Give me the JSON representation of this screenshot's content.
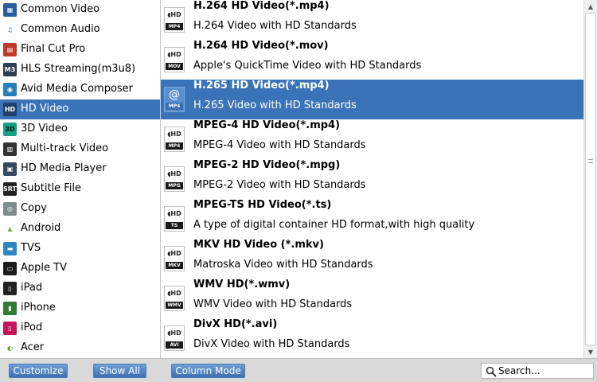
{
  "sidebar": {
    "items": [
      {
        "label": "Common Video",
        "icon": "film-icon",
        "glyph": "▦",
        "color": "#2b5d9c",
        "fg": "#fff"
      },
      {
        "label": "Common Audio",
        "icon": "music-note-icon",
        "glyph": "♫",
        "color": "transparent",
        "fg": "#2f6fbf"
      },
      {
        "label": "Final Cut Pro",
        "icon": "clapperboard-icon",
        "glyph": "▤",
        "color": "#c0392b",
        "fg": "#fff"
      },
      {
        "label": "HLS Streaming(m3u8)",
        "icon": "m3u8-icon",
        "glyph": "M3",
        "color": "#2c3e50",
        "fg": "#fff"
      },
      {
        "label": "Avid Media Composer",
        "icon": "avid-icon",
        "glyph": "◉",
        "color": "#2980b9",
        "fg": "#fff"
      },
      {
        "label": "HD Video",
        "icon": "hd-icon",
        "glyph": "HD",
        "color": "#1f3f66",
        "fg": "#fff"
      },
      {
        "label": "3D Video",
        "icon": "3d-icon",
        "glyph": "3D",
        "color": "#16a085",
        "fg": "#111"
      },
      {
        "label": "Multi-track Video",
        "icon": "filmstrip-icon",
        "glyph": "▥",
        "color": "#333333",
        "fg": "#fff"
      },
      {
        "label": "HD Media Player",
        "icon": "media-player-icon",
        "glyph": "▣",
        "color": "#34495e",
        "fg": "#fff"
      },
      {
        "label": "Subtitle File",
        "icon": "subtitle-icon",
        "glyph": "SRT",
        "color": "#222222",
        "fg": "#fff"
      },
      {
        "label": "Copy",
        "icon": "disc-copy-icon",
        "glyph": "◎",
        "color": "#7f8c8d",
        "fg": "#fff"
      },
      {
        "label": "Android",
        "icon": "android-icon",
        "glyph": "▲",
        "color": "transparent",
        "fg": "#7cb342"
      },
      {
        "label": "TVS",
        "icon": "tv-icon",
        "glyph": "▬",
        "color": "#2e86c1",
        "fg": "#fff"
      },
      {
        "label": "Apple TV",
        "icon": "apple-tv-icon",
        "glyph": "▭",
        "color": "#1c1c1c",
        "fg": "#fff"
      },
      {
        "label": "iPad",
        "icon": "ipad-icon",
        "glyph": "▯",
        "color": "#222222",
        "fg": "#fff"
      },
      {
        "label": "iPhone",
        "icon": "iphone-icon",
        "glyph": "▮",
        "color": "#2e7d32",
        "fg": "#fff"
      },
      {
        "label": "iPod",
        "icon": "ipod-icon",
        "glyph": "▯",
        "color": "#c2185b",
        "fg": "#fff"
      },
      {
        "label": "Acer",
        "icon": "acer-icon",
        "glyph": "◐",
        "color": "transparent",
        "fg": "#5a9e2f"
      }
    ],
    "selected_index": 5
  },
  "formats": {
    "items": [
      {
        "name": "H.264 HD Video(*.mp4)",
        "desc": "H.264 Video with HD Standards",
        "hd": "◖HD",
        "ext": "MP4"
      },
      {
        "name": "H.264 HD Video(*.mov)",
        "desc": "Apple's QuickTime Video with HD Standards",
        "hd": "◖HD",
        "ext": "MOV"
      },
      {
        "name": "H.265 HD Video(*.mp4)",
        "desc": "H.265 Video with HD Standards",
        "hd": "@",
        "ext": "MP4"
      },
      {
        "name": "MPEG-4 HD Video(*.mp4)",
        "desc": "MPEG-4 Video with HD Standards",
        "hd": "◖HD",
        "ext": "MP4"
      },
      {
        "name": "MPEG-2 HD Video(*.mpg)",
        "desc": "MPEG-2 Video with HD Standards",
        "hd": "◖HD",
        "ext": "MPG"
      },
      {
        "name": "MPEG-TS HD Video(*.ts)",
        "desc": "A type of digital container HD format,with high quality",
        "hd": "◖HD",
        "ext": "TS"
      },
      {
        "name": "MKV HD Video (*.mkv)",
        "desc": "Matroska Video with HD Standards",
        "hd": "◖HD",
        "ext": "MKV"
      },
      {
        "name": "WMV HD(*.wmv)",
        "desc": "WMV Video with HD Standards",
        "hd": "◖HD",
        "ext": "WMV"
      },
      {
        "name": "DivX HD(*.avi)",
        "desc": "DivX Video with HD Standards",
        "hd": "◖HD",
        "ext": "AVI"
      }
    ],
    "selected_index": 2
  },
  "toolbar": {
    "customize_label": "Customize",
    "show_all_label": "Show All",
    "column_mode_label": "Column Mode"
  },
  "search": {
    "placeholder": "Search..."
  },
  "colors": {
    "selection": "#3b73b9",
    "button": "#4a7bb7"
  }
}
